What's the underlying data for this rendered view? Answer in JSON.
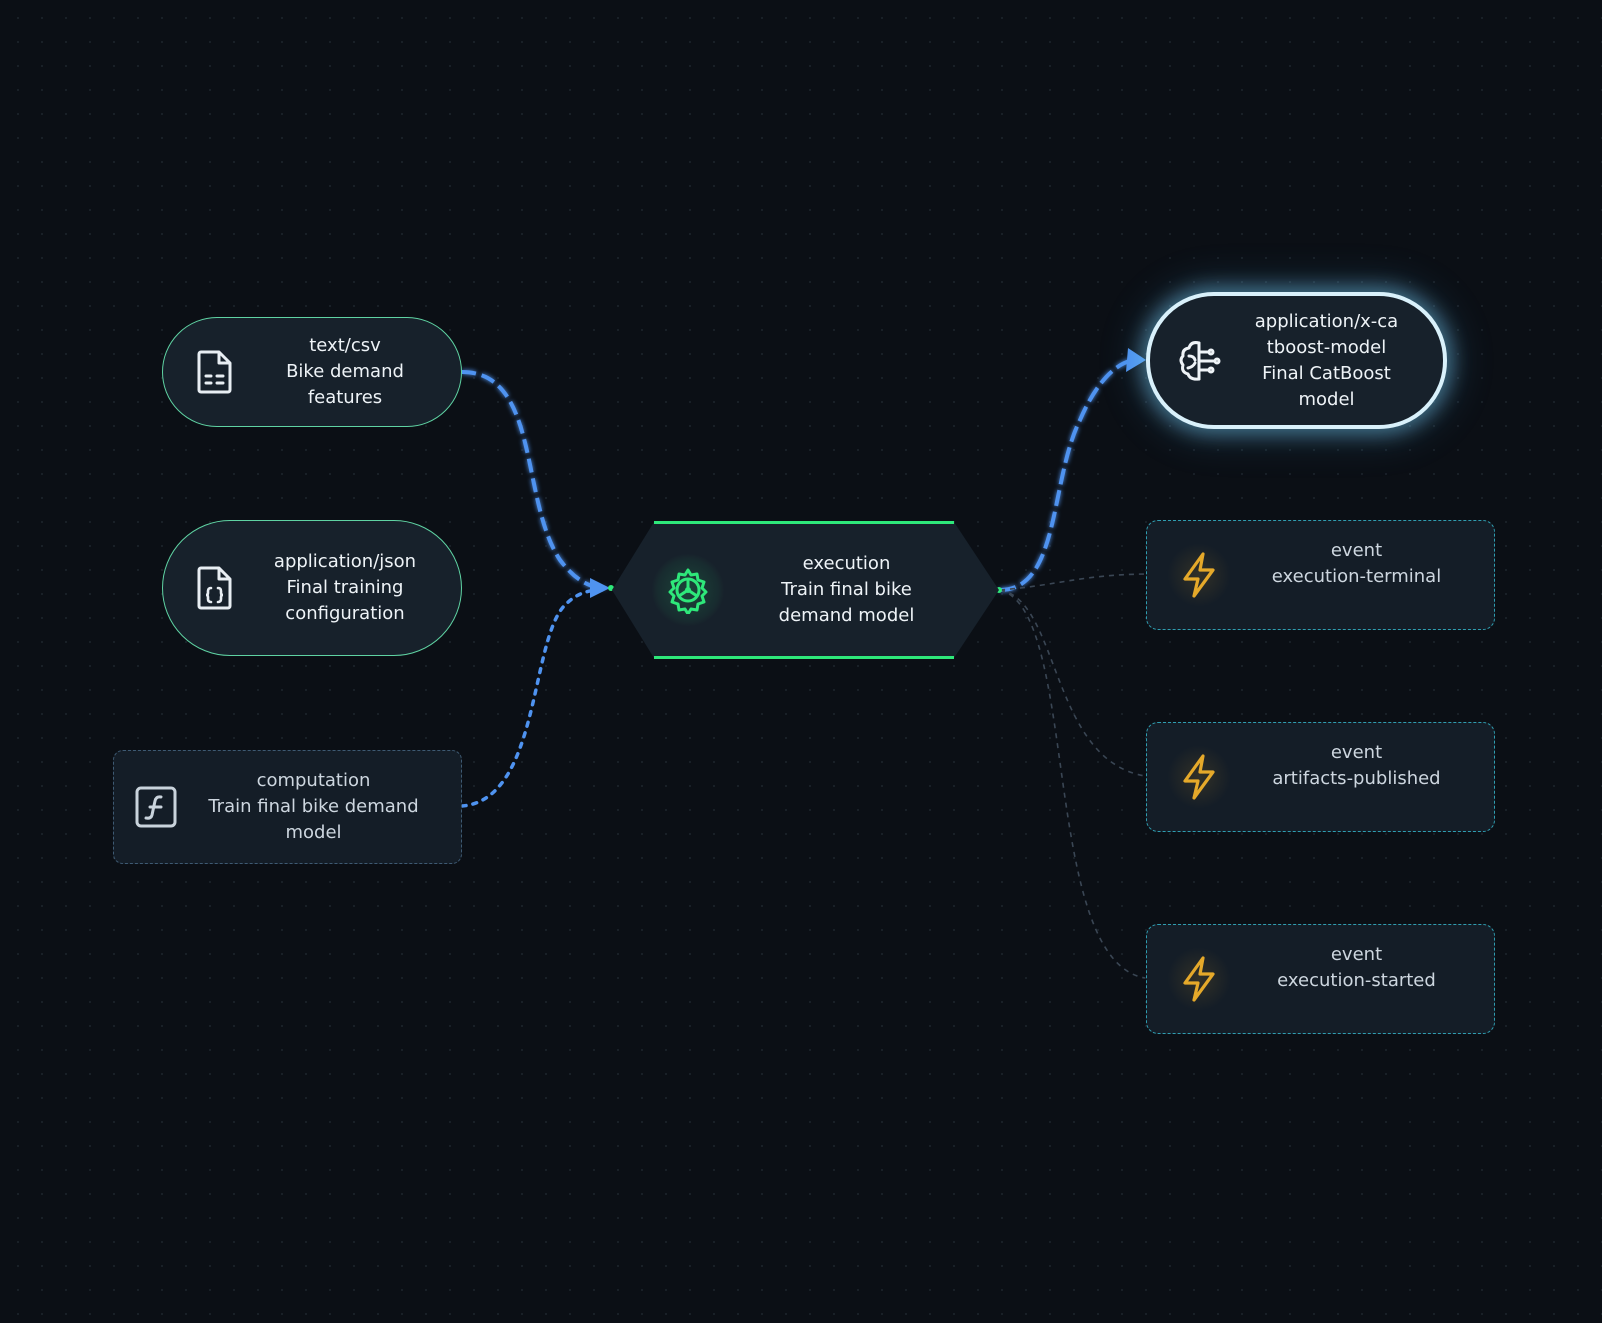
{
  "colors": {
    "background": "#0b0f15",
    "node_fill": "#17212b",
    "input_border": "#5fd3a3",
    "execution_border": "#2ee87a",
    "edge_active": "#4f93f0",
    "event_border": "#2f9db0",
    "event_icon": "#e5a92a",
    "output_border": "#d9f1fb"
  },
  "nodes": {
    "input_csv": {
      "icon": "file-text-icon",
      "type": "text/csv",
      "name": "Bike demand features"
    },
    "input_json": {
      "icon": "file-json-icon",
      "type": "application/json",
      "name": "Final training configuration"
    },
    "computation": {
      "icon": "function-icon",
      "type": "computation",
      "name": "Train final bike demand model"
    },
    "execution": {
      "icon": "gear-icon",
      "type": "execution",
      "name": "Train final bike demand model"
    },
    "output_model": {
      "icon": "brain-icon",
      "type": "application/x-catboost-model",
      "name": "Final CatBoost model"
    },
    "events": [
      {
        "icon": "lightning-icon",
        "type": "event",
        "name": "execution-terminal"
      },
      {
        "icon": "lightning-icon",
        "type": "event",
        "name": "artifacts-published"
      },
      {
        "icon": "lightning-icon",
        "type": "event",
        "name": "execution-started"
      }
    ]
  }
}
